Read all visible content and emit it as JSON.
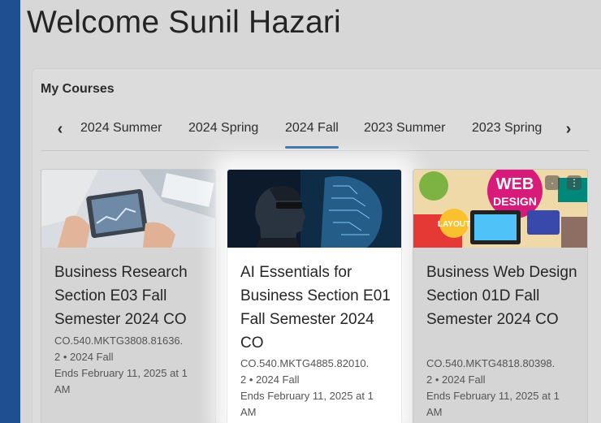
{
  "header": {
    "welcome": "Welcome Sunil Hazari"
  },
  "widget": {
    "title": "My Courses",
    "tabs": [
      {
        "label": "2024 Summer"
      },
      {
        "label": "2024 Spring"
      },
      {
        "label": "2024 Fall",
        "active": true
      },
      {
        "label": "2023 Summer"
      },
      {
        "label": "2023 Spring"
      }
    ],
    "prev_icon": "‹",
    "next_icon": "›"
  },
  "courses": [
    {
      "title": "Business Research Section E03 Fall Semester 2024 CO",
      "code": "CO.540.MKTG3808.81636.",
      "code_line2": "2 • 2024 Fall",
      "ends": "Ends February 11, 2025 at 1",
      "ends_line2": "AM",
      "image": "tablet-chart-photo"
    },
    {
      "title": "AI Essentials for Business Section E01 Fall Semester 2024 CO",
      "code": "CO.540.MKTG4885.82010.",
      "code_line2": "2 • 2024 Fall",
      "ends": "Ends February 11, 2025 at 1",
      "ends_line2": "AM",
      "image": "ai-head-circuit-photo"
    },
    {
      "title": "Business Web Design Section 01D Fall Semester 2024 CO",
      "code": "CO.540.MKTG4818.80398.",
      "code_line2": "2 • 2024 Fall",
      "ends": "Ends February 11, 2025 at 1",
      "ends_line2": "AM",
      "image": "web-design-photo",
      "image_text_1": "WEB",
      "image_text_2": "DESIGN",
      "image_text_3": "LAYOUT"
    }
  ],
  "colors": {
    "frame": "#1f4f8f",
    "tab_active": "#1d5d9b"
  }
}
